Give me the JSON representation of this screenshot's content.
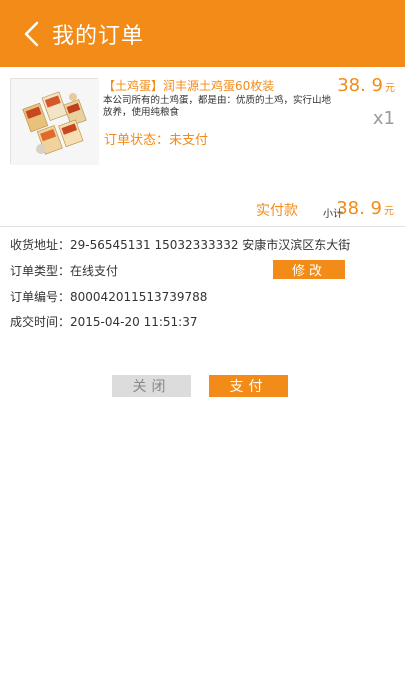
{
  "header": {
    "title": "我的订单"
  },
  "order_item": {
    "name": "【土鸡蛋】润丰源土鸡蛋60枚装",
    "description": "本公司所有的土鸡蛋，都是由：优质的土鸡，实行山地放养，使用纯粮食",
    "status_text": "订单状态：未支付",
    "price": "38. 9",
    "price_unit": "元",
    "quantity": "x1"
  },
  "summary": {
    "paid_label": "实付款",
    "subtotal_label": "小计",
    "subtotal": "38. 9",
    "subtotal_unit": "元"
  },
  "details": {
    "address_label": "收货地址：",
    "address_value": "29-56545131  15032333332   安康市汉滨区东大街",
    "type_label": "订单类型：",
    "type_value": "在线支付",
    "order_no_label": "订单编号：",
    "order_no_value": "800042011513739788",
    "time_label": "成交时间：",
    "time_value": "2015-04-20 11:51:37"
  },
  "buttons": {
    "modify": "修改",
    "close": "关闭",
    "pay": "支付"
  },
  "colors": {
    "accent": "#f28b17",
    "button_gray": "#dcdcdc"
  }
}
